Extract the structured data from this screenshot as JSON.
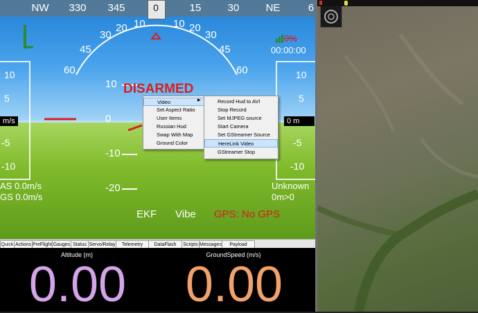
{
  "compass": {
    "labels": [
      "NW",
      "330",
      "345",
      "0",
      "15",
      "30",
      "NE",
      "6"
    ],
    "heading": "0"
  },
  "hud": {
    "status": "DISARMED",
    "timer": "00:00:00",
    "battery_pct": "0%",
    "speed_ticks": [
      "10",
      "5",
      "-5",
      "-10"
    ],
    "speed_unit": "m/s",
    "alt_ticks": [
      "10",
      "5",
      "-5",
      "-10"
    ],
    "alt_current": "0 m",
    "pitch_labels": [
      "10",
      "0",
      "-10",
      "-20",
      "10",
      "-10"
    ],
    "roll_labels": [
      "60",
      "45",
      "30",
      "20",
      "10",
      "0",
      "10",
      "20",
      "30",
      "45",
      "60"
    ],
    "airspeed": "AS 0.0m/s",
    "groundspeed": "GS 0.0m/s",
    "alt_mode": "Unknown",
    "alt_sub": "0m>0",
    "ekf": "EKF",
    "vibe": "Vibe",
    "gps": "GPS: No GPS"
  },
  "context_menu": {
    "items": [
      "Video",
      "Set Aspect Ratio",
      "User Items",
      "Russian Hud",
      "Swap With Map",
      "Ground Color"
    ],
    "submenu": [
      "Record Hud to AVI",
      "Stop Record",
      "Set MJPEG source",
      "Start Camera",
      "Set GStreamer Source",
      "HereLink Video",
      "GStreamer Stop"
    ],
    "highlighted": "HereLink Video"
  },
  "tabs": [
    "Quick",
    "Actions",
    "PreFlight",
    "Gauges",
    "Status",
    "Servo/Relay",
    "Telemetry Logs",
    "DataFlash Logs",
    "Scripts",
    "Messages",
    "Payload Control"
  ],
  "quick": {
    "left_label": "Altitude (m)",
    "left_value": "0.00",
    "right_label": "GroundSpeed (m/s)",
    "right_value": "0.00",
    "left_color": "#d4a3e8",
    "right_color": "#f0a26a"
  }
}
